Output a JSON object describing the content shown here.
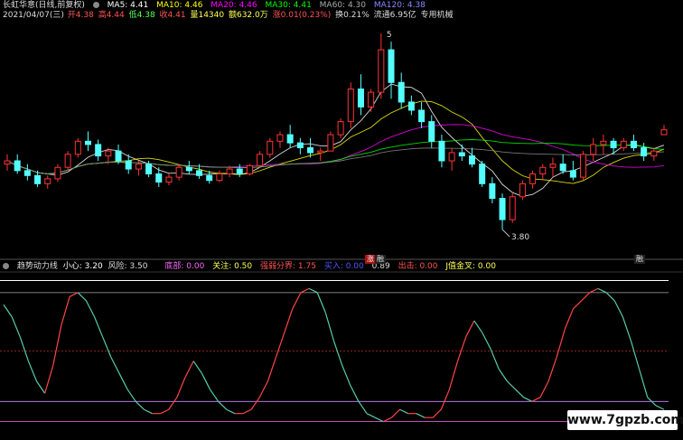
{
  "header": {
    "stock_name": "长虹华意(日线,前复权)",
    "ma5": "MA5: 4.41",
    "ma10": "MA10: 4.46",
    "ma20": "MA20: 4.46",
    "ma30": "MA30: 4.41",
    "ma60": "MA60: 4.30",
    "ma120": "MA120: 4.38"
  },
  "quote_bar": {
    "date": "2021/04/07(三)",
    "open": "开4.38",
    "high": "高4.44",
    "low": "低4.38",
    "close": "收4.41",
    "volume": "量14340",
    "amount": "额632.0万",
    "change": "涨0.01(0.23%)",
    "turnover": "换0.21%",
    "float_cap": "流通6.95亿",
    "sector": "专用机械"
  },
  "indicator": {
    "name": "趋势动力线",
    "caution": "小心: 3.20",
    "risk": "风险: 3.50",
    "bottom": "底部: 0.00",
    "focus": "关注: 0.50",
    "line1": "强弱分界: 1.75",
    "line2": "买入: 0.00",
    "line3": "0.89",
    "line4": "出击: 0.00",
    "line5": "J值金叉: 0.00"
  },
  "annotations": {
    "high_label": "5",
    "low_label": "3.80",
    "badge_left": "涨",
    "badge_left2": "融",
    "badge_right": "融"
  },
  "watermark": "www.7gpzb.com",
  "colors": {
    "up": "#ff3333",
    "down": "#54ffff",
    "ma5": "#ffffff",
    "ma10": "#ffff00",
    "ma20": "#ff00ff",
    "ma30": "#00ff00",
    "ma60": "#888888",
    "ma120": "#5050ff"
  },
  "chart_data": {
    "type": "candlestick",
    "y_range": [
      3.7,
      5.05
    ],
    "candles": [
      [
        4.2,
        4.26,
        4.16,
        4.22
      ],
      [
        4.22,
        4.26,
        4.14,
        4.16
      ],
      [
        4.16,
        4.2,
        4.1,
        4.13
      ],
      [
        4.13,
        4.16,
        4.06,
        4.08
      ],
      [
        4.08,
        4.13,
        4.05,
        4.11
      ],
      [
        4.11,
        4.2,
        4.09,
        4.18
      ],
      [
        4.18,
        4.28,
        4.16,
        4.26
      ],
      [
        4.26,
        4.36,
        4.24,
        4.34
      ],
      [
        4.34,
        4.4,
        4.28,
        4.32
      ],
      [
        4.32,
        4.35,
        4.22,
        4.25
      ],
      [
        4.25,
        4.3,
        4.2,
        4.28
      ],
      [
        4.28,
        4.32,
        4.2,
        4.22
      ],
      [
        4.22,
        4.26,
        4.14,
        4.17
      ],
      [
        4.17,
        4.22,
        4.13,
        4.2
      ],
      [
        4.2,
        4.22,
        4.12,
        4.14
      ],
      [
        4.14,
        4.18,
        4.06,
        4.09
      ],
      [
        4.09,
        4.14,
        4.07,
        4.12
      ],
      [
        4.12,
        4.2,
        4.1,
        4.18
      ],
      [
        4.18,
        4.22,
        4.14,
        4.16
      ],
      [
        4.16,
        4.2,
        4.11,
        4.13
      ],
      [
        4.13,
        4.16,
        4.08,
        4.1
      ],
      [
        4.1,
        4.16,
        4.09,
        4.14
      ],
      [
        4.14,
        4.19,
        4.12,
        4.17
      ],
      [
        4.17,
        4.2,
        4.12,
        4.14
      ],
      [
        4.14,
        4.2,
        4.13,
        4.19
      ],
      [
        4.19,
        4.28,
        4.18,
        4.26
      ],
      [
        4.26,
        4.36,
        4.24,
        4.34
      ],
      [
        4.34,
        4.4,
        4.3,
        4.38
      ],
      [
        4.38,
        4.44,
        4.3,
        4.33
      ],
      [
        4.33,
        4.36,
        4.26,
        4.3
      ],
      [
        4.3,
        4.36,
        4.24,
        4.27
      ],
      [
        4.27,
        4.3,
        4.22,
        4.28
      ],
      [
        4.28,
        4.4,
        4.28,
        4.38
      ],
      [
        4.38,
        4.48,
        4.36,
        4.46
      ],
      [
        4.46,
        4.7,
        4.42,
        4.66
      ],
      [
        4.66,
        4.75,
        4.5,
        4.55
      ],
      [
        4.55,
        4.66,
        4.52,
        4.64
      ],
      [
        4.64,
        5.0,
        4.6,
        4.9
      ],
      [
        4.9,
        4.95,
        4.6,
        4.7
      ],
      [
        4.7,
        4.76,
        4.54,
        4.58
      ],
      [
        4.58,
        4.62,
        4.5,
        4.53
      ],
      [
        4.53,
        4.58,
        4.42,
        4.46
      ],
      [
        4.46,
        4.5,
        4.3,
        4.34
      ],
      [
        4.34,
        4.38,
        4.18,
        4.22
      ],
      [
        4.22,
        4.3,
        4.16,
        4.27
      ],
      [
        4.27,
        4.32,
        4.22,
        4.25
      ],
      [
        4.25,
        4.3,
        4.18,
        4.2
      ],
      [
        4.2,
        4.22,
        4.06,
        4.08
      ],
      [
        4.08,
        4.12,
        3.96,
        3.99
      ],
      [
        3.99,
        4.02,
        3.8,
        3.86
      ],
      [
        3.86,
        4.02,
        3.84,
        4.0
      ],
      [
        4.0,
        4.1,
        3.98,
        4.08
      ],
      [
        4.08,
        4.16,
        4.05,
        4.14
      ],
      [
        4.14,
        4.2,
        4.1,
        4.18
      ],
      [
        4.18,
        4.24,
        4.12,
        4.2
      ],
      [
        4.2,
        4.26,
        4.14,
        4.16
      ],
      [
        4.16,
        4.22,
        4.1,
        4.12
      ],
      [
        4.12,
        4.28,
        4.1,
        4.26
      ],
      [
        4.26,
        4.36,
        4.22,
        4.32
      ],
      [
        4.32,
        4.38,
        4.26,
        4.34
      ],
      [
        4.34,
        4.36,
        4.26,
        4.3
      ],
      [
        4.3,
        4.36,
        4.28,
        4.34
      ],
      [
        4.34,
        4.38,
        4.28,
        4.3
      ],
      [
        4.3,
        4.33,
        4.22,
        4.25
      ],
      [
        4.25,
        4.3,
        4.22,
        4.28
      ],
      [
        4.38,
        4.44,
        4.38,
        4.41
      ]
    ],
    "indicator_line": [
      2.9,
      2.6,
      2.1,
      1.5,
      1.0,
      0.7,
      1.4,
      2.4,
      3.1,
      3.2,
      3.0,
      2.6,
      2.1,
      1.6,
      1.2,
      0.8,
      0.5,
      0.3,
      0.2,
      0.2,
      0.3,
      0.6,
      1.1,
      1.5,
      1.2,
      0.8,
      0.5,
      0.3,
      0.2,
      0.2,
      0.3,
      0.6,
      1.0,
      1.6,
      2.2,
      2.8,
      3.2,
      3.3,
      3.2,
      2.7,
      2.0,
      1.4,
      0.9,
      0.5,
      0.2,
      0.1,
      0.0,
      0.1,
      0.3,
      0.2,
      0.2,
      0.1,
      0.1,
      0.3,
      0.8,
      1.5,
      2.1,
      2.5,
      2.2,
      1.8,
      1.3,
      1.0,
      0.8,
      0.6,
      0.5,
      0.6,
      1.0,
      1.6,
      2.3,
      2.8,
      3.0,
      3.2,
      3.3,
      3.2,
      3.0,
      2.6,
      2.0,
      1.3,
      0.6,
      0.4,
      0.3
    ],
    "indicator_range": [
      -0.3,
      3.6
    ],
    "levels": {
      "risk": 3.5,
      "caution": 3.2,
      "strong_weak": 1.75,
      "focus": 0.5,
      "bottom": 0.0
    }
  }
}
